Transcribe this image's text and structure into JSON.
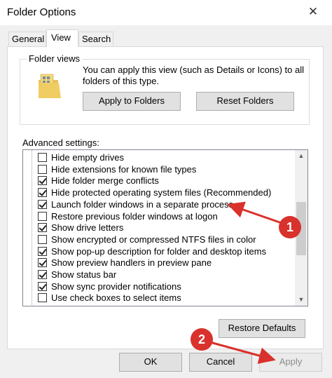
{
  "window": {
    "title": "Folder Options",
    "close_icon": "close-icon"
  },
  "tabs": [
    {
      "label": "General",
      "active": false
    },
    {
      "label": "View",
      "active": true
    },
    {
      "label": "Search",
      "active": false
    }
  ],
  "folder_views": {
    "group_label": "Folder views",
    "icon": "folder-icon",
    "description": "You can apply this view (such as Details or Icons) to all folders of this type.",
    "apply_button": "Apply to Folders",
    "reset_button": "Reset Folders"
  },
  "advanced": {
    "label": "Advanced settings:",
    "items": [
      {
        "label": "Hide empty drives",
        "checked": false
      },
      {
        "label": "Hide extensions for known file types",
        "checked": false
      },
      {
        "label": "Hide folder merge conflicts",
        "checked": true
      },
      {
        "label": "Hide protected operating system files (Recommended)",
        "checked": true
      },
      {
        "label": "Launch folder windows in a separate process",
        "checked": true
      },
      {
        "label": "Restore previous folder windows at logon",
        "checked": false
      },
      {
        "label": "Show drive letters",
        "checked": true
      },
      {
        "label": "Show encrypted or compressed NTFS files in color",
        "checked": false
      },
      {
        "label": "Show pop-up description for folder and desktop items",
        "checked": true
      },
      {
        "label": "Show preview handlers in preview pane",
        "checked": true
      },
      {
        "label": "Show status bar",
        "checked": true
      },
      {
        "label": "Show sync provider notifications",
        "checked": true
      },
      {
        "label": "Use check boxes to select items",
        "checked": false
      }
    ],
    "restore_button": "Restore Defaults"
  },
  "footer": {
    "ok": "OK",
    "cancel": "Cancel",
    "apply": "Apply"
  },
  "annotations": {
    "badge_1": "1",
    "badge_2": "2",
    "color": "#d9312c"
  }
}
